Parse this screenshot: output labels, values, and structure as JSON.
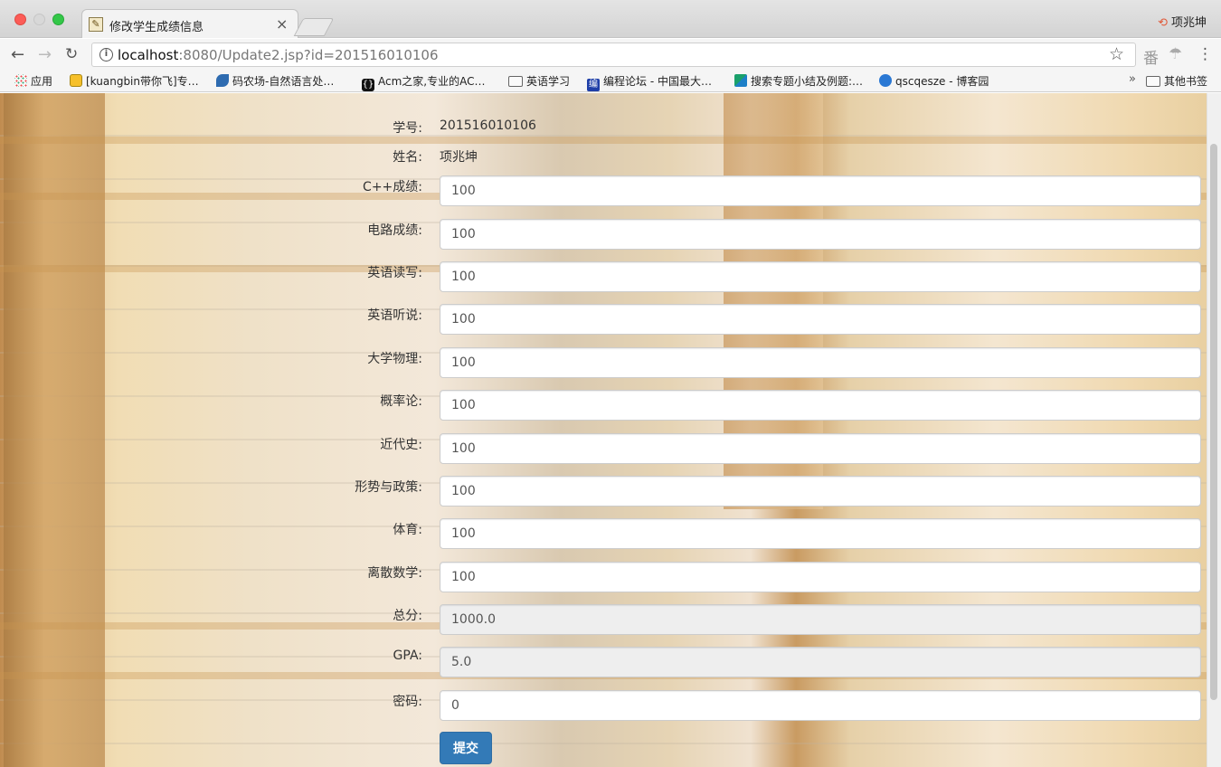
{
  "browser": {
    "tab_title": "修改学生成绩信息",
    "tab_close": "×",
    "profile_name": "项兆坤",
    "url_host": "localhost",
    "url_rest": ":8080/Update2.jsp?id=201516010106"
  },
  "bookmarks": [
    {
      "label": "应用",
      "icon": "apps-grid-icon"
    },
    {
      "label": "[kuangbin带你飞]专…",
      "icon": "smiley-icon"
    },
    {
      "label": "码农场-自然语言处…",
      "icon": "leaf-icon"
    },
    {
      "label": "Acm之家,专业的AC…",
      "icon": "brace-icon"
    },
    {
      "label": "英语学习",
      "icon": "folder-icon"
    },
    {
      "label": "编程论坛 - 中国最大…",
      "icon": "bianchen-icon"
    },
    {
      "label": "搜索专题小结及例题:…",
      "icon": "green-logo-icon"
    },
    {
      "label": "qscqesze - 博客园",
      "icon": "blog-icon"
    }
  ],
  "bookmarks_more": "»",
  "other_bookmarks": "其他书签",
  "form": {
    "student_id_label": "学号:",
    "student_id": "201516010106",
    "name_label": "姓名:",
    "name": "项兆坤",
    "fields": [
      {
        "label": "C++成绩:",
        "value": "100",
        "readonly": false
      },
      {
        "label": "电路成绩:",
        "value": "100",
        "readonly": false
      },
      {
        "label": "英语读写:",
        "value": "100",
        "readonly": false
      },
      {
        "label": "英语听说:",
        "value": "100",
        "readonly": false
      },
      {
        "label": "大学物理:",
        "value": "100",
        "readonly": false
      },
      {
        "label": "概率论:",
        "value": "100",
        "readonly": false
      },
      {
        "label": "近代史:",
        "value": "100",
        "readonly": false
      },
      {
        "label": "形势与政策:",
        "value": "100",
        "readonly": false
      },
      {
        "label": "体育:",
        "value": "100",
        "readonly": false
      },
      {
        "label": "离散数学:",
        "value": "100",
        "readonly": false
      },
      {
        "label": "总分:",
        "value": "1000.0",
        "readonly": true
      },
      {
        "label": "GPA:",
        "value": "5.0",
        "readonly": true
      },
      {
        "label": "密码:",
        "value": "0",
        "readonly": false
      }
    ],
    "submit_label": "提交"
  },
  "colors": {
    "primary_button": "#337ab7",
    "readonly_bg": "#eeeeee"
  }
}
